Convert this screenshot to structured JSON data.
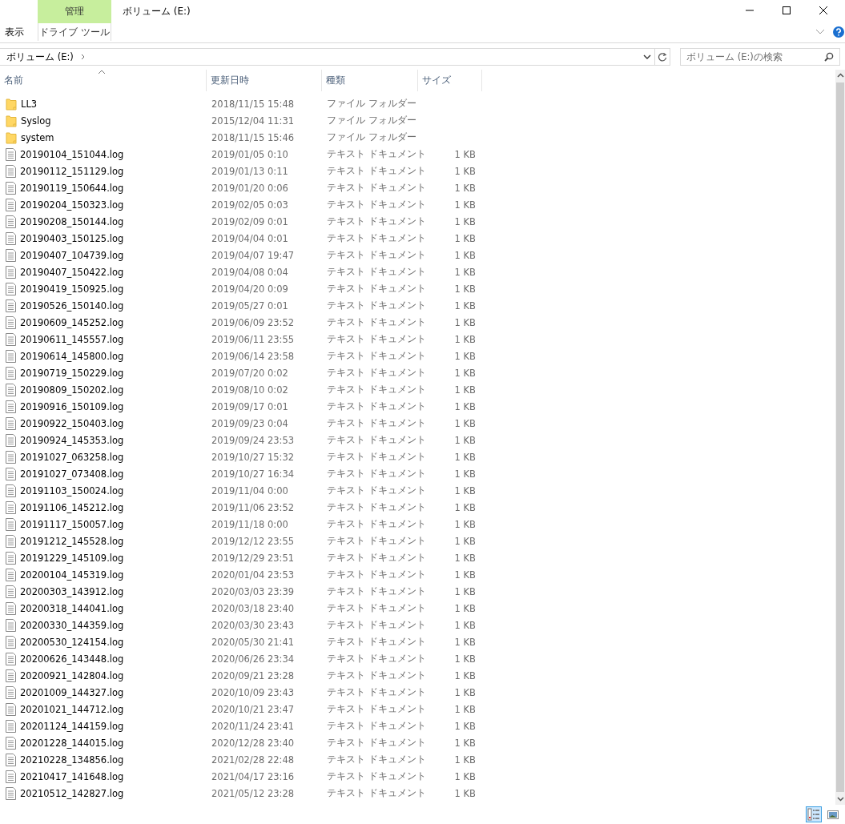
{
  "window": {
    "title": "ボリューム (E:)"
  },
  "ribbon": {
    "tabs": [
      {
        "label": "表示",
        "selected": false
      }
    ],
    "context_group": {
      "label": "管理",
      "tab": "ドライブ ツール"
    }
  },
  "address": {
    "path": [
      "ボリューム (E:)"
    ]
  },
  "search": {
    "placeholder": "ボリューム (E:)の検索"
  },
  "columns": [
    {
      "label": "名前",
      "sorted": true
    },
    {
      "label": "更新日時",
      "sorted": false
    },
    {
      "label": "種類",
      "sorted": false
    },
    {
      "label": "サイズ",
      "sorted": false
    }
  ],
  "rows": [
    {
      "kind": "folder",
      "name": "LL3",
      "modified": "2018/11/15 15:48",
      "type": "ファイル フォルダー"
    },
    {
      "kind": "folder",
      "name": "Syslog",
      "modified": "2015/12/04 11:31",
      "type": "ファイル フォルダー"
    },
    {
      "kind": "folder",
      "name": "system",
      "modified": "2018/11/15 15:46",
      "type": "ファイル フォルダー"
    },
    {
      "kind": "file",
      "name": "20190104_151044.log",
      "modified": "2019/01/05 0:10",
      "type": "テキスト ドキュメント",
      "size": "1 KB"
    },
    {
      "kind": "file",
      "name": "20190112_151129.log",
      "modified": "2019/01/13 0:11",
      "type": "テキスト ドキュメント",
      "size": "1 KB"
    },
    {
      "kind": "file",
      "name": "20190119_150644.log",
      "modified": "2019/01/20 0:06",
      "type": "テキスト ドキュメント",
      "size": "1 KB"
    },
    {
      "kind": "file",
      "name": "20190204_150323.log",
      "modified": "2019/02/05 0:03",
      "type": "テキスト ドキュメント",
      "size": "1 KB"
    },
    {
      "kind": "file",
      "name": "20190208_150144.log",
      "modified": "2019/02/09 0:01",
      "type": "テキスト ドキュメント",
      "size": "1 KB"
    },
    {
      "kind": "file",
      "name": "20190403_150125.log",
      "modified": "2019/04/04 0:01",
      "type": "テキスト ドキュメント",
      "size": "1 KB"
    },
    {
      "kind": "file",
      "name": "20190407_104739.log",
      "modified": "2019/04/07 19:47",
      "type": "テキスト ドキュメント",
      "size": "1 KB"
    },
    {
      "kind": "file",
      "name": "20190407_150422.log",
      "modified": "2019/04/08 0:04",
      "type": "テキスト ドキュメント",
      "size": "1 KB"
    },
    {
      "kind": "file",
      "name": "20190419_150925.log",
      "modified": "2019/04/20 0:09",
      "type": "テキスト ドキュメント",
      "size": "1 KB"
    },
    {
      "kind": "file",
      "name": "20190526_150140.log",
      "modified": "2019/05/27 0:01",
      "type": "テキスト ドキュメント",
      "size": "1 KB"
    },
    {
      "kind": "file",
      "name": "20190609_145252.log",
      "modified": "2019/06/09 23:52",
      "type": "テキスト ドキュメント",
      "size": "1 KB"
    },
    {
      "kind": "file",
      "name": "20190611_145557.log",
      "modified": "2019/06/11 23:55",
      "type": "テキスト ドキュメント",
      "size": "1 KB"
    },
    {
      "kind": "file",
      "name": "20190614_145800.log",
      "modified": "2019/06/14 23:58",
      "type": "テキスト ドキュメント",
      "size": "1 KB"
    },
    {
      "kind": "file",
      "name": "20190719_150229.log",
      "modified": "2019/07/20 0:02",
      "type": "テキスト ドキュメント",
      "size": "1 KB"
    },
    {
      "kind": "file",
      "name": "20190809_150202.log",
      "modified": "2019/08/10 0:02",
      "type": "テキスト ドキュメント",
      "size": "1 KB"
    },
    {
      "kind": "file",
      "name": "20190916_150109.log",
      "modified": "2019/09/17 0:01",
      "type": "テキスト ドキュメント",
      "size": "1 KB"
    },
    {
      "kind": "file",
      "name": "20190922_150403.log",
      "modified": "2019/09/23 0:04",
      "type": "テキスト ドキュメント",
      "size": "1 KB"
    },
    {
      "kind": "file",
      "name": "20190924_145353.log",
      "modified": "2019/09/24 23:53",
      "type": "テキスト ドキュメント",
      "size": "1 KB"
    },
    {
      "kind": "file",
      "name": "20191027_063258.log",
      "modified": "2019/10/27 15:32",
      "type": "テキスト ドキュメント",
      "size": "1 KB"
    },
    {
      "kind": "file",
      "name": "20191027_073408.log",
      "modified": "2019/10/27 16:34",
      "type": "テキスト ドキュメント",
      "size": "1 KB"
    },
    {
      "kind": "file",
      "name": "20191103_150024.log",
      "modified": "2019/11/04 0:00",
      "type": "テキスト ドキュメント",
      "size": "1 KB"
    },
    {
      "kind": "file",
      "name": "20191106_145212.log",
      "modified": "2019/11/06 23:52",
      "type": "テキスト ドキュメント",
      "size": "1 KB"
    },
    {
      "kind": "file",
      "name": "20191117_150057.log",
      "modified": "2019/11/18 0:00",
      "type": "テキスト ドキュメント",
      "size": "1 KB"
    },
    {
      "kind": "file",
      "name": "20191212_145528.log",
      "modified": "2019/12/12 23:55",
      "type": "テキスト ドキュメント",
      "size": "1 KB"
    },
    {
      "kind": "file",
      "name": "20191229_145109.log",
      "modified": "2019/12/29 23:51",
      "type": "テキスト ドキュメント",
      "size": "1 KB"
    },
    {
      "kind": "file",
      "name": "20200104_145319.log",
      "modified": "2020/01/04 23:53",
      "type": "テキスト ドキュメント",
      "size": "1 KB"
    },
    {
      "kind": "file",
      "name": "20200303_143912.log",
      "modified": "2020/03/03 23:39",
      "type": "テキスト ドキュメント",
      "size": "1 KB"
    },
    {
      "kind": "file",
      "name": "20200318_144041.log",
      "modified": "2020/03/18 23:40",
      "type": "テキスト ドキュメント",
      "size": "1 KB"
    },
    {
      "kind": "file",
      "name": "20200330_144359.log",
      "modified": "2020/03/30 23:43",
      "type": "テキスト ドキュメント",
      "size": "1 KB"
    },
    {
      "kind": "file",
      "name": "20200530_124154.log",
      "modified": "2020/05/30 21:41",
      "type": "テキスト ドキュメント",
      "size": "1 KB"
    },
    {
      "kind": "file",
      "name": "20200626_143448.log",
      "modified": "2020/06/26 23:34",
      "type": "テキスト ドキュメント",
      "size": "1 KB"
    },
    {
      "kind": "file",
      "name": "20200921_142804.log",
      "modified": "2020/09/21 23:28",
      "type": "テキスト ドキュメント",
      "size": "1 KB"
    },
    {
      "kind": "file",
      "name": "20201009_144327.log",
      "modified": "2020/10/09 23:43",
      "type": "テキスト ドキュメント",
      "size": "1 KB"
    },
    {
      "kind": "file",
      "name": "20201021_144712.log",
      "modified": "2020/10/21 23:47",
      "type": "テキスト ドキュメント",
      "size": "1 KB"
    },
    {
      "kind": "file",
      "name": "20201124_144159.log",
      "modified": "2020/11/24 23:41",
      "type": "テキスト ドキュメント",
      "size": "1 KB"
    },
    {
      "kind": "file",
      "name": "20201228_144015.log",
      "modified": "2020/12/28 23:40",
      "type": "テキスト ドキュメント",
      "size": "1 KB"
    },
    {
      "kind": "file",
      "name": "20210228_134856.log",
      "modified": "2021/02/28 22:48",
      "type": "テキスト ドキュメント",
      "size": "1 KB"
    },
    {
      "kind": "file",
      "name": "20210417_141648.log",
      "modified": "2021/04/17 23:16",
      "type": "テキスト ドキュメント",
      "size": "1 KB"
    },
    {
      "kind": "file",
      "name": "20210512_142827.log",
      "modified": "2021/05/12 23:28",
      "type": "テキスト ドキュメント",
      "size": "1 KB"
    }
  ],
  "view_buttons": [
    {
      "kind": "details",
      "selected": true
    },
    {
      "kind": "large_icons",
      "selected": false
    }
  ]
}
